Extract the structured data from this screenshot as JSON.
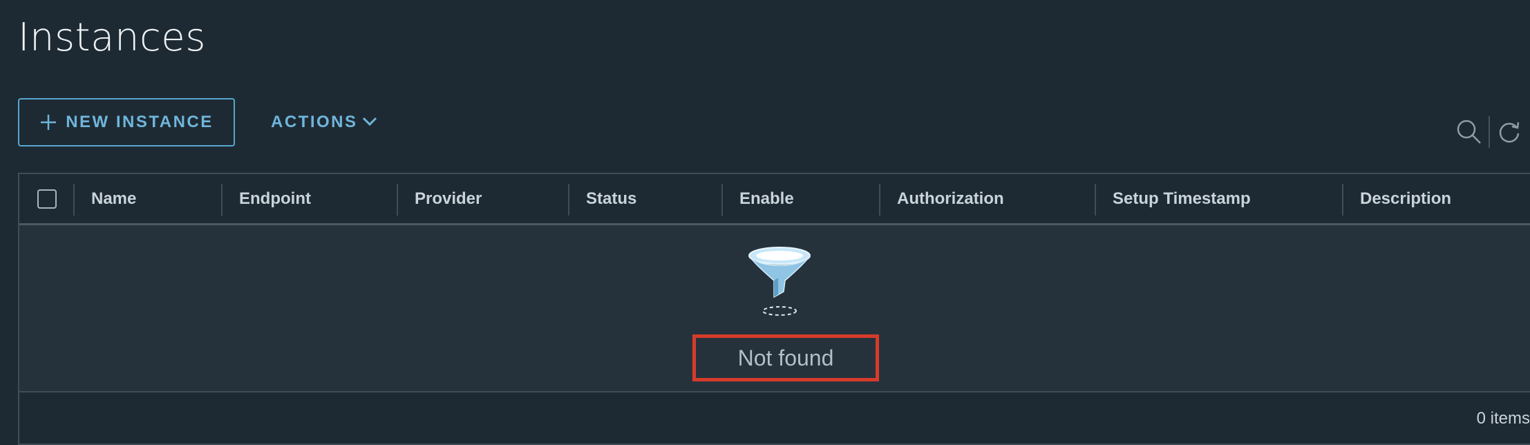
{
  "page": {
    "title": "Instances"
  },
  "toolbar": {
    "new_instance_label": "NEW INSTANCE",
    "actions_label": "ACTIONS",
    "search_icon": "search-icon",
    "refresh_icon": "refresh-icon"
  },
  "grid": {
    "columns": [
      "Name",
      "Endpoint",
      "Provider",
      "Status",
      "Enable",
      "Authorization",
      "Setup Timestamp",
      "Description"
    ],
    "empty_message": "Not found",
    "empty_icon": "funnel-icon",
    "footer_count": "0 items"
  },
  "colors": {
    "accent": "#6fb6dc",
    "background": "#1e2a33",
    "highlight": "#d73b2a"
  }
}
